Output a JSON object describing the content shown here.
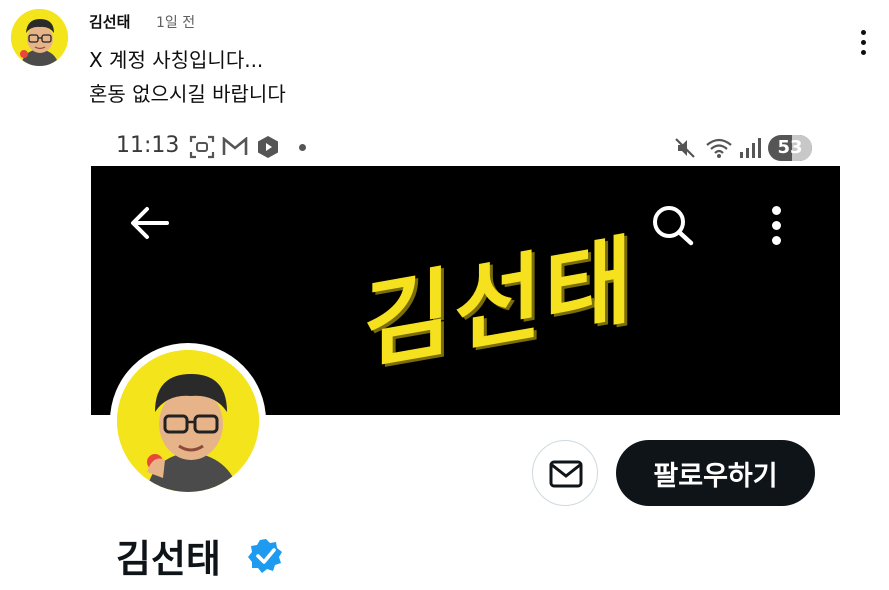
{
  "comment": {
    "author": "김선태",
    "time": "1일 전",
    "lines": [
      "X 계정 사칭입니다...",
      "혼동 없으시길 바랍니다"
    ]
  },
  "phone": {
    "status_bar": {
      "time": "11:13",
      "battery": "53"
    },
    "banner": {
      "logo_text": "김선태",
      "logo_color": "#f5e11d"
    },
    "profile": {
      "display_name": "김선태",
      "follow_label": "팔로우하기",
      "verified_color": "#1d9bf0"
    }
  },
  "colors": {
    "avatar_bg": "#f4e41c",
    "button_dark": "#0f1419"
  }
}
